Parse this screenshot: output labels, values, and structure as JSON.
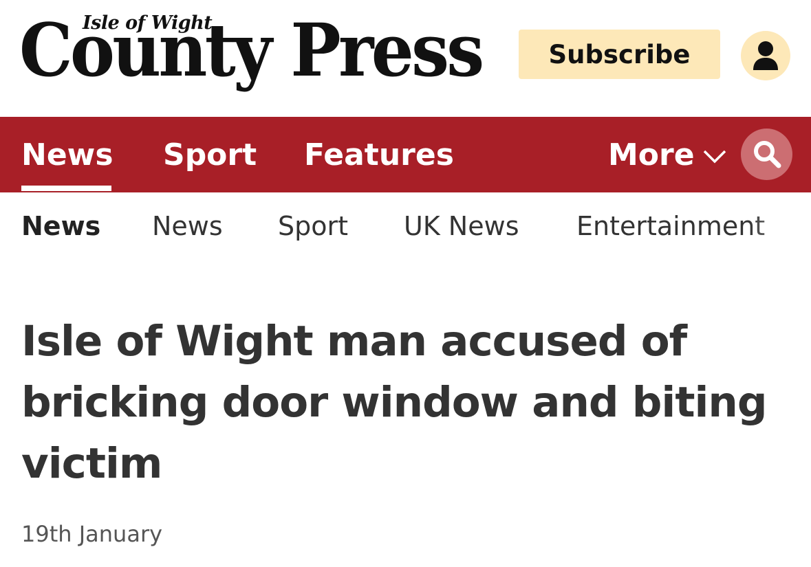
{
  "masthead": {
    "logo_small": "Isle of Wight",
    "logo_big": "County Press",
    "subscribe_label": "Subscribe",
    "subscribe_bg": "#fde8b8"
  },
  "primary_nav": {
    "bg_color": "#a81f27",
    "items": [
      {
        "label": "News",
        "active": true
      },
      {
        "label": "Sport",
        "active": false
      },
      {
        "label": "Features",
        "active": false
      }
    ],
    "more_label": "More",
    "more_icon": "chevron-down-icon",
    "search_icon": "search-icon"
  },
  "secondary_nav": {
    "items": [
      {
        "label": "News",
        "active": true
      },
      {
        "label": "News",
        "active": false
      },
      {
        "label": "Sport",
        "active": false
      },
      {
        "label": "UK News",
        "active": false
      },
      {
        "label": "Entertainment",
        "active": false
      }
    ]
  },
  "article": {
    "headline": "Isle of Wight man accused of bricking door window and biting victim",
    "date": "19th January"
  }
}
